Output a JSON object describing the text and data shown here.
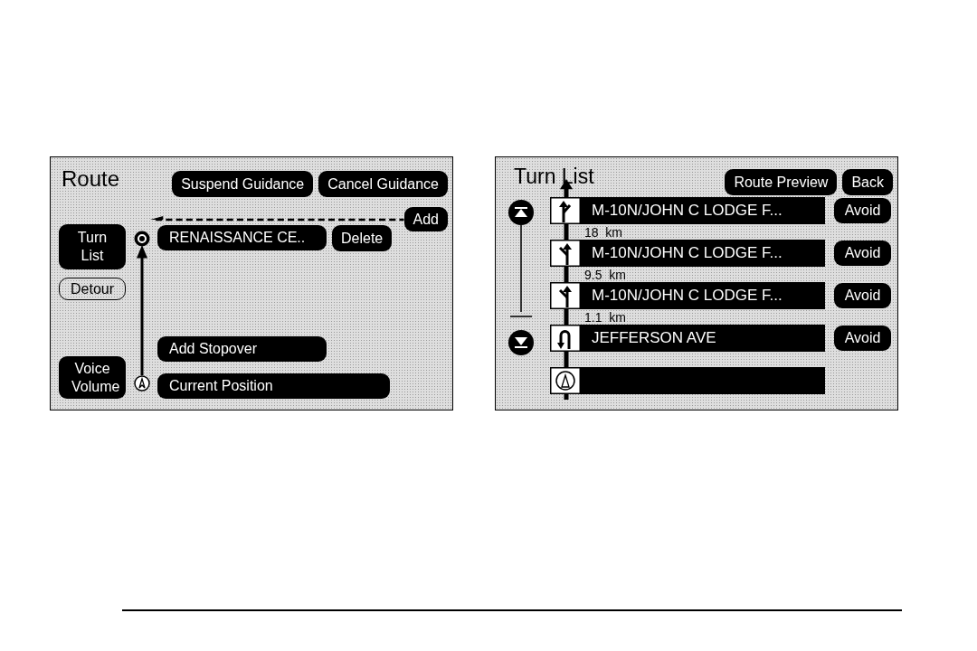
{
  "route_screen": {
    "title": "Route",
    "suspend_button": "Suspend Guidance",
    "cancel_button": "Cancel Guidance",
    "add_button": "Add",
    "turn_list_button": "Turn List",
    "detour_button": "Detour",
    "voice_volume_button": "Voice Volume",
    "destination": {
      "name": "RENAISSANCE CE..",
      "delete_button": "Delete"
    },
    "add_stopover_button": "Add Stopover",
    "current_position_button": "Current Position"
  },
  "turn_list_screen": {
    "title": "Turn List",
    "route_preview_button": "Route Preview",
    "back_button": "Back",
    "turns": [
      {
        "kind": "keep_right",
        "street": "M-10N/JOHN C LODGE F...",
        "distance": "18  km",
        "avoid_button": "Avoid"
      },
      {
        "kind": "keep_left",
        "street": "M-10N/JOHN C LODGE F...",
        "distance": "9.5  km",
        "avoid_button": "Avoid"
      },
      {
        "kind": "keep_left",
        "street": "M-10N/JOHN C LODGE F...",
        "distance": "1.1  km",
        "avoid_button": "Avoid"
      },
      {
        "kind": "u_turn",
        "street": "JEFFERSON AVE",
        "avoid_button": "Avoid"
      },
      {
        "kind": "current_position"
      }
    ]
  }
}
